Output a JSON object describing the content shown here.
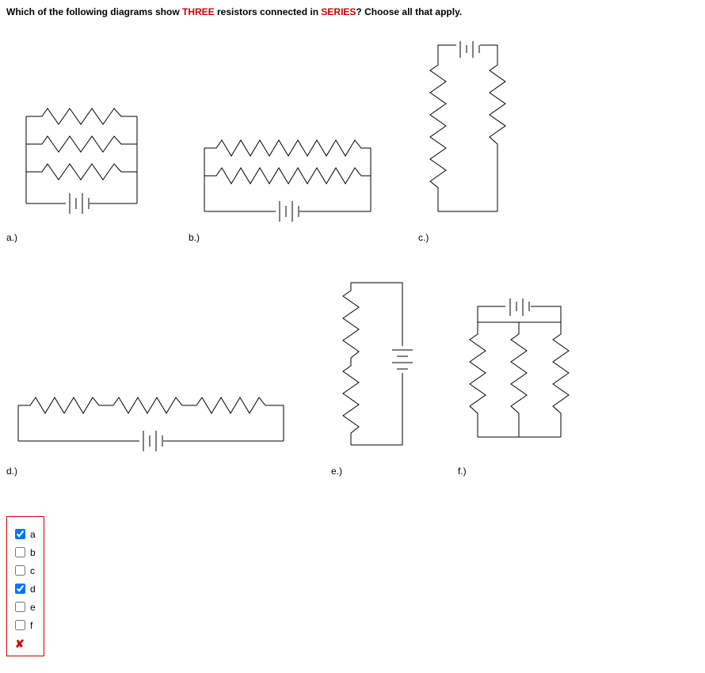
{
  "question": {
    "pre": "Which of the following diagrams show ",
    "em1": "THREE",
    "mid": " resistors connected in ",
    "em2": "SERIES",
    "post": "? Choose all that apply."
  },
  "labels": {
    "a": "a.)",
    "b": "b.)",
    "c": "c.)",
    "d": "d.)",
    "e": "e.)",
    "f": "f.)"
  },
  "answers": {
    "a": {
      "label": "a",
      "checked": true
    },
    "b": {
      "label": "b",
      "checked": false
    },
    "c": {
      "label": "c",
      "checked": false
    },
    "d": {
      "label": "d",
      "checked": true
    },
    "e": {
      "label": "e",
      "checked": false
    },
    "f": {
      "label": "f",
      "checked": false
    }
  },
  "feedback": "✘"
}
